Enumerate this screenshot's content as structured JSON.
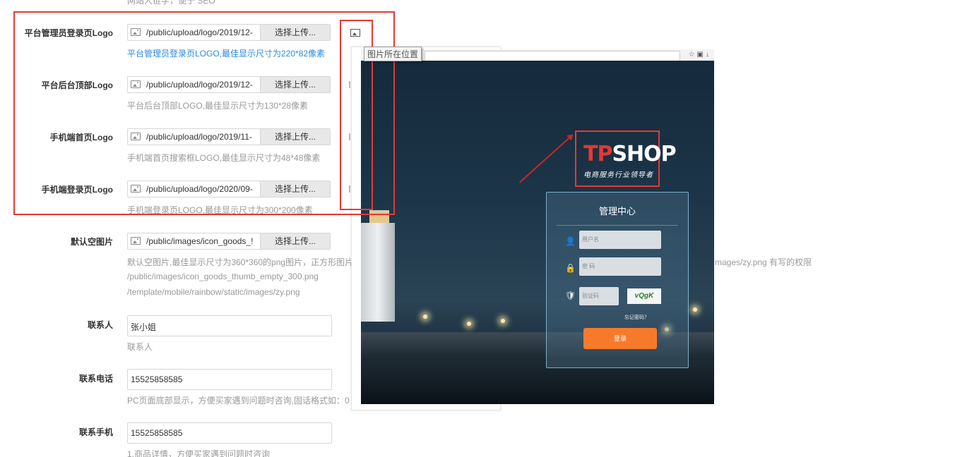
{
  "top_hint": "网站人链学，便于 SEO",
  "logo_rows": [
    {
      "label": "平台管理员登录页Logo",
      "path": "/public/upload/logo/2019/12-",
      "button": "选择上传...",
      "hint": "平台管理员登录页LOGO,最佳显示尺寸为220*82像素"
    },
    {
      "label": "平台后台顶部Logo",
      "path": "/public/upload/logo/2019/12-",
      "button": "选择上传...",
      "hint": "平台后台顶部LOGO,最佳显示尺寸为130*28像素"
    },
    {
      "label": "手机端首页Logo",
      "path": "/public/upload/logo/2019/11-",
      "button": "选择上传...",
      "hint": "手机端首页搜索框LOGO,最佳显示尺寸为48*48像素"
    },
    {
      "label": "手机端登录页Logo",
      "path": "/public/upload/logo/2020/09-",
      "button": "选择上传...",
      "hint": "手机端登录页LOGO,最佳显示尺寸为300*200像素"
    }
  ],
  "default_image": {
    "label": "默认空图片",
    "path": "/public/images/icon_goods_!",
    "button": "选择上传...",
    "hint_line1": "默认空图片,最佳显示尺寸为360*360的png图片，正方形图片",
    "hint_line1_tail": "mages/zy.png 有写的权限",
    "hint_line2": "/public/images/icon_goods_thumb_empty_300.png",
    "hint_line3": "/template/mobile/rainbow/static/images/zy.png"
  },
  "contact": {
    "label": "联系人",
    "value": "张小姐",
    "hint": "联系人"
  },
  "phone": {
    "label": "联系电话",
    "value": "15525858585",
    "hint": "PC页面底部显示，方便买家遇到问题时咨询,固话格式如：0"
  },
  "mobile": {
    "label": "联系手机",
    "value": "15525858585",
    "hint": "1.商品详情，方便买家遇到问题时咨询"
  },
  "preview": {
    "tooltip": "图片所在位置",
    "logo_red": "TP",
    "logo_white": "SHOP",
    "logo_sub": "电商服务行业领导者",
    "login_title": "管理中心",
    "username_placeholder": "用户名",
    "password_placeholder": "密 码",
    "captcha_placeholder": "验证码",
    "captcha_text": "vQgK",
    "forgot": "忘记密码？",
    "login_button": "登录"
  },
  "colors": {
    "accent_red": "#e53935",
    "hint_blue": "#2a8ae0",
    "login_orange": "#f77a2b"
  }
}
